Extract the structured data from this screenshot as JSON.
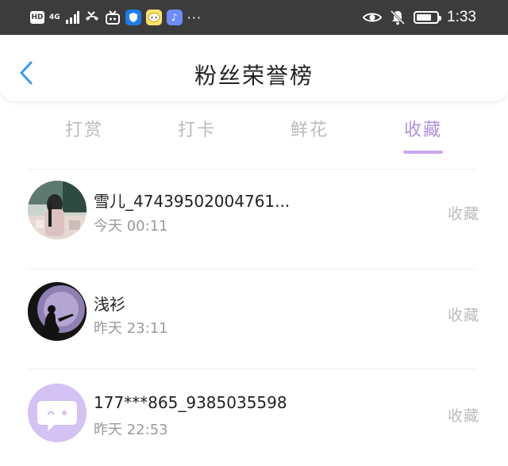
{
  "status_bar": {
    "hd": "HD",
    "network": "4G",
    "time": "1:33",
    "more": "···",
    "battery_level": 0.75
  },
  "header": {
    "title": "粉丝荣誉榜"
  },
  "tabs": [
    {
      "label": "打赏",
      "active": false
    },
    {
      "label": "打卡",
      "active": false
    },
    {
      "label": "鲜花",
      "active": false
    },
    {
      "label": "收藏",
      "active": true
    }
  ],
  "list": [
    {
      "name": "雪儿_47439502004761...",
      "time": "今天 00:11",
      "action": "收藏"
    },
    {
      "name": "浅衫",
      "time": "昨天 23:11",
      "action": "收藏"
    },
    {
      "name": "177***865_9385035598",
      "time": "昨天 22:53",
      "action": "收藏"
    }
  ],
  "colors": {
    "accent": "#b28fe4",
    "back_arrow": "#3a9cf0",
    "status_bar_bg": "#3c3c3c"
  }
}
